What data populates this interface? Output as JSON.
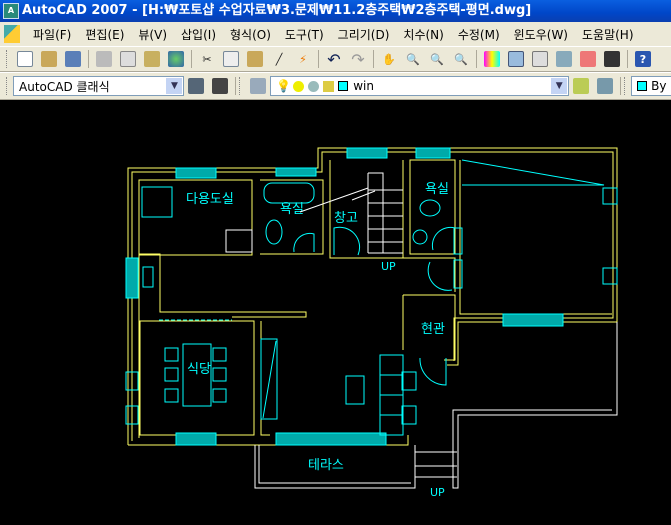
{
  "title": "AutoCAD 2007 - [H:₩포토샵 수업자료₩3.문제₩11.2층주택₩2층주택-평면.dwg]",
  "menu": [
    "파일(F)",
    "편집(E)",
    "뷰(V)",
    "삽입(I)",
    "형식(O)",
    "도구(T)",
    "그리기(D)",
    "치수(N)",
    "수정(M)",
    "윈도우(W)",
    "도움말(H)"
  ],
  "toolbar": {
    "workspace": "AutoCAD 클래식",
    "layer": "win",
    "color": "By"
  },
  "plan": {
    "rooms": [
      "다용도실",
      "욕실",
      "창고",
      "욕실",
      "식당",
      "현관",
      "테라스"
    ],
    "up1": "UP",
    "up2": "UP"
  },
  "colors": {
    "wall": "#ffff66",
    "window": "#00ffff",
    "line": "#ffffff"
  }
}
